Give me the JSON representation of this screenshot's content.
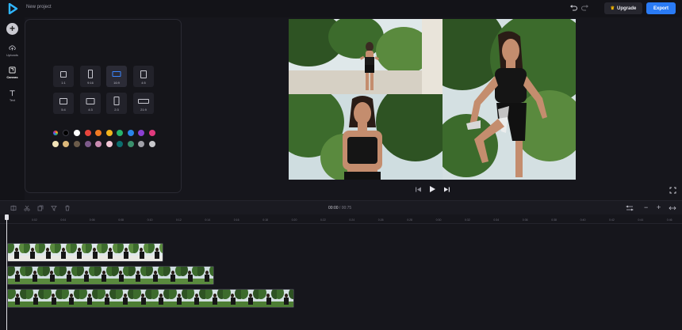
{
  "app": {
    "project_title": "New project",
    "upgrade_label": "Upgrade",
    "export_label": "Export",
    "brand_color": "#2a7bf5"
  },
  "sidebar": {
    "add_icon": "plus-icon",
    "items": [
      {
        "label": "Uploads",
        "icon": "upload-icon"
      },
      {
        "label": "Canvas",
        "icon": "canvas-icon",
        "active": true
      },
      {
        "label": "Text",
        "icon": "text-icon"
      }
    ]
  },
  "canvas_panel": {
    "ratios": [
      {
        "label": "1:1"
      },
      {
        "label": "9:16"
      },
      {
        "label": "16:9",
        "active": true
      },
      {
        "label": "4:5"
      },
      {
        "label": "5:4"
      },
      {
        "label": "4:3"
      },
      {
        "label": "2:3"
      },
      {
        "label": "21:9"
      }
    ],
    "colors": [
      "#f4f1ec",
      "#000000",
      "#ffffff",
      "#e8453c",
      "#f07a23",
      "#f2b51d",
      "#27b36b",
      "#2a84e8",
      "#8a3fd1",
      "#e03a7e",
      "#f2e3b8",
      "#dcb77a",
      "#6b5b4a",
      "#7c5a8a",
      "#c98bb0",
      "#f3c7d6",
      "#0b6e6e",
      "#3a8f6c",
      "#a0a0a8",
      "#c8c8cc"
    ]
  },
  "player": {
    "prev_icon": "skip-back-icon",
    "play_icon": "play-icon",
    "next_icon": "skip-forward-icon",
    "fullscreen_icon": "fullscreen-icon"
  },
  "timeline": {
    "current_time": "00:00",
    "separator": "/",
    "duration": "00:75",
    "ticks": [
      "0:02",
      "0:04",
      "0:06",
      "0:08",
      "0:10",
      "0:12",
      "0:14",
      "0:16",
      "0:18",
      "0:20",
      "0:22",
      "0:24",
      "0:26",
      "0:28",
      "0:30",
      "0:32",
      "0:34",
      "0:36",
      "0:38",
      "0:40",
      "0:42",
      "0:44",
      "0:46"
    ],
    "zoom_out_label": "−",
    "zoom_in_label": "+"
  }
}
